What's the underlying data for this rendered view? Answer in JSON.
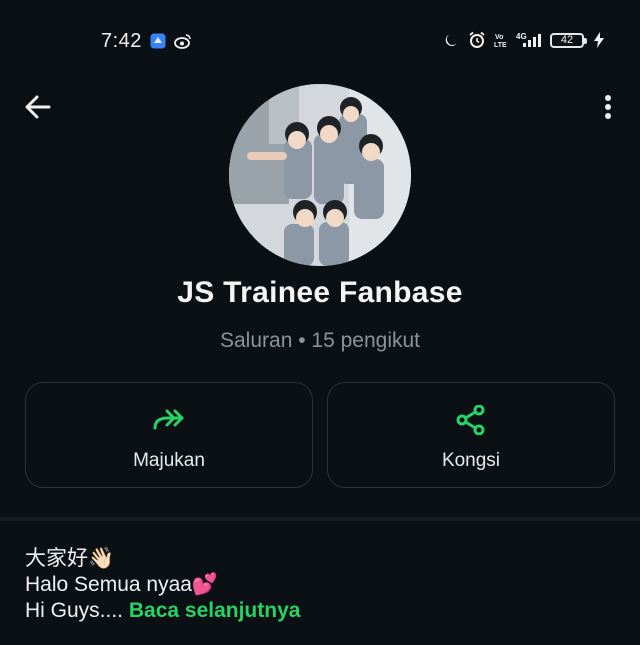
{
  "status_bar": {
    "time": "7:42",
    "app_icons": [
      "shield-app-icon",
      "weibo-icon"
    ],
    "right_icons": [
      "moon-icon",
      "alarm-icon",
      "volte-icon",
      "4g-signal-icon"
    ],
    "network_label": "4G",
    "battery_level": "42"
  },
  "header": {
    "back_icon": "arrow-left-icon",
    "more_icon": "more-vertical-icon"
  },
  "channel": {
    "name": "JS Trainee Fanbase",
    "meta": "Saluran • 15 pengikut"
  },
  "actions": {
    "forward": {
      "label": "Majukan",
      "icon": "forward-icon"
    },
    "share": {
      "label": "Kongsi",
      "icon": "share-icon"
    }
  },
  "description": {
    "line1": "大家好👋🏻",
    "line2": "Halo Semua nyaa💕",
    "line3": "Hi Guys.... ",
    "read_more": "Baca selanjutnya"
  },
  "colors": {
    "background": "#0b1014",
    "accent": "#25d366",
    "muted_text": "#8a9499",
    "border": "#2b3338"
  }
}
